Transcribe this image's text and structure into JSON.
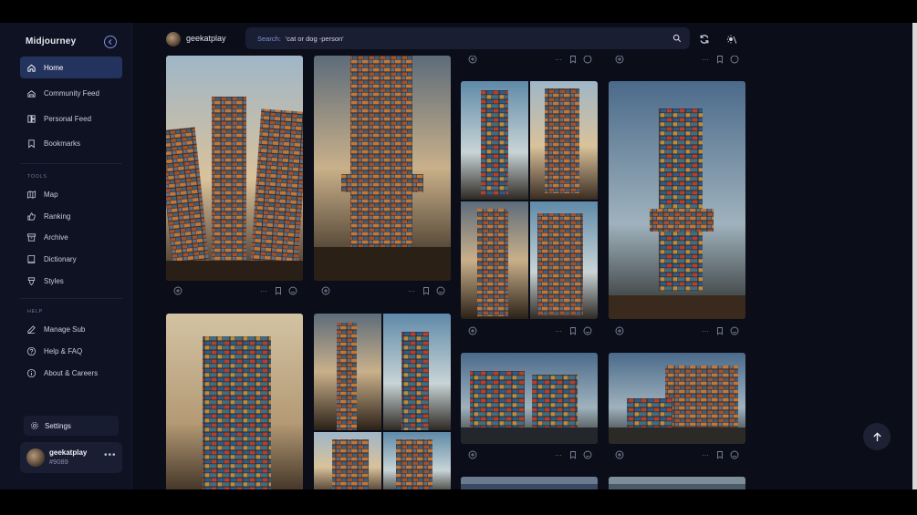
{
  "app": {
    "brand": "Midjourney"
  },
  "sidebar": {
    "main_items": [
      {
        "label": "Home",
        "icon": "home-icon",
        "active": true
      },
      {
        "label": "Community Feed",
        "icon": "community-icon",
        "active": false
      },
      {
        "label": "Personal Feed",
        "icon": "personal-feed-icon",
        "active": false
      },
      {
        "label": "Bookmarks",
        "icon": "bookmark-icon",
        "active": false
      }
    ],
    "tools_label": "TOOLS",
    "tools_items": [
      {
        "label": "Map",
        "icon": "map-icon"
      },
      {
        "label": "Ranking",
        "icon": "thumbs-up-icon"
      },
      {
        "label": "Archive",
        "icon": "archive-icon"
      },
      {
        "label": "Dictionary",
        "icon": "dictionary-icon"
      },
      {
        "label": "Styles",
        "icon": "styles-icon"
      }
    ],
    "help_label": "HELP",
    "help_items": [
      {
        "label": "Manage Sub",
        "icon": "edit-icon"
      },
      {
        "label": "Help & FAQ",
        "icon": "question-icon"
      },
      {
        "label": "About & Careers",
        "icon": "info-icon"
      }
    ],
    "settings_label": "Settings",
    "user": {
      "name": "geekatplay",
      "tag": "#9089"
    }
  },
  "topbar": {
    "username": "geekatplay",
    "search": {
      "label": "Search:",
      "value": "'cat or dog -person'"
    }
  },
  "feed": {
    "image_subject": "stacked shipping container towers"
  },
  "colors": {
    "background": "#0b0d19",
    "sidebar": "#0f1222",
    "active_nav": "#24335e",
    "accent": "#7d8fd8"
  }
}
